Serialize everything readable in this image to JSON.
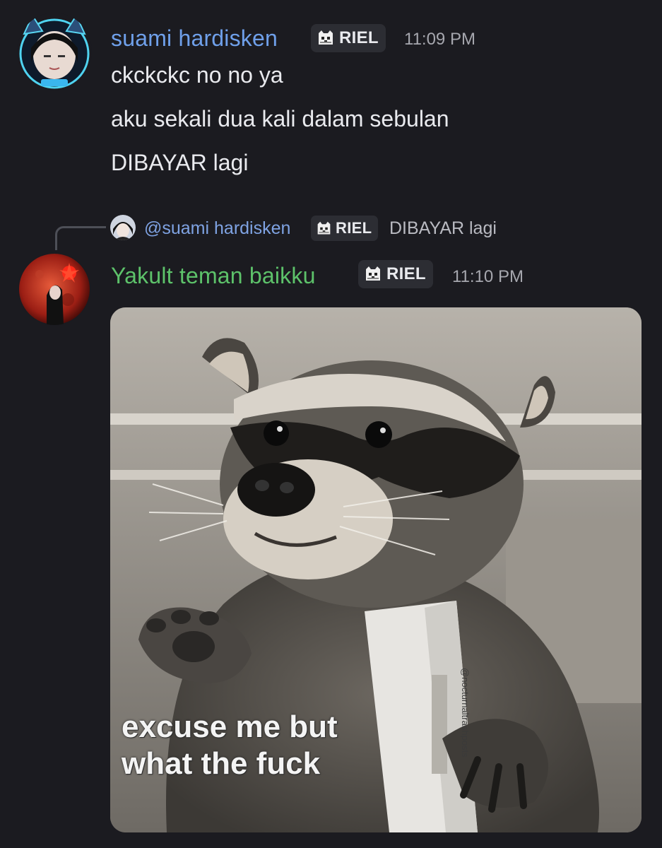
{
  "messages": [
    {
      "username": "suami hardisken",
      "username_color": "#6fa0ea",
      "tag": "RIEL",
      "timestamp": "11:09 PM",
      "avatar_icon": "anime-avatar-cat-ears",
      "lines": [
        "ckckckc no no ya",
        "aku sekali dua kali dalam sebulan",
        "DIBAYAR lagi"
      ]
    },
    {
      "reply_to": {
        "mention": "@suami hardisken",
        "tag": "RIEL",
        "text": "DIBAYAR lagi",
        "avatar_icon": "anime-avatar-small"
      },
      "username": "Yakult teman baikku",
      "username_color": "#5dc26a",
      "tag": "RIEL",
      "timestamp": "11:10 PM",
      "avatar_icon": "red-moon-avatar",
      "attachment": {
        "description_icon": "raccoon-meme-image",
        "caption_line1": "excuse me but",
        "caption_line2": "what the fuck",
        "watermark": "@nocturnaltrashposts"
      }
    }
  ],
  "tag_icon": "cat-pixel-icon"
}
